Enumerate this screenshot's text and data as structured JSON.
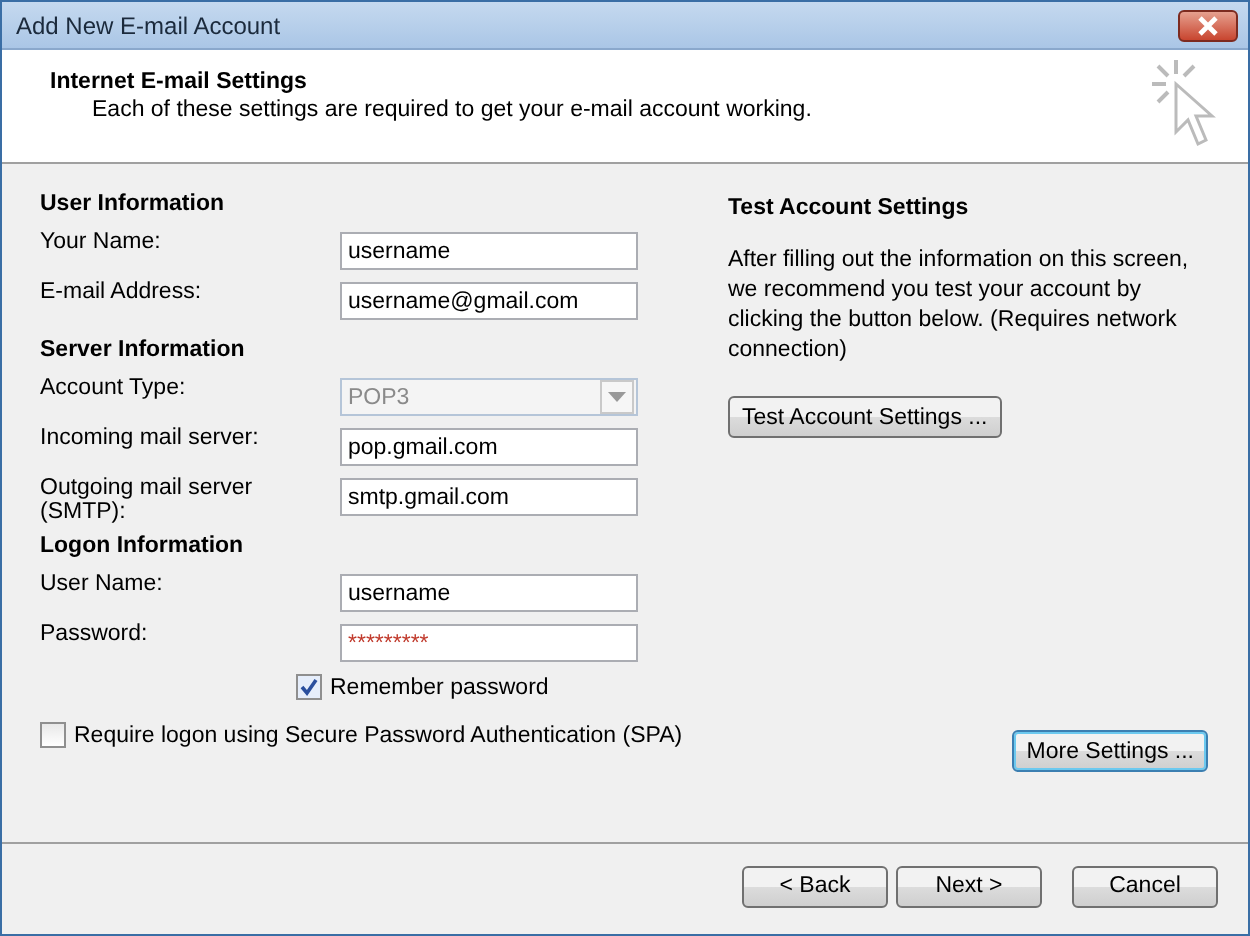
{
  "window": {
    "title": "Add New E-mail Account"
  },
  "header": {
    "title": "Internet E-mail Settings",
    "subtitle": "Each of these settings are required to get your e-mail account working."
  },
  "sections": [
    {
      "title": "User Information",
      "fields": [
        {
          "kind": "text",
          "label": "Your Name:",
          "value": "username",
          "disabled": false
        },
        {
          "kind": "text",
          "label": "E-mail Address:",
          "value": "username@gmail.com",
          "disabled": false
        }
      ]
    },
    {
      "title": "Server Information",
      "fields": [
        {
          "kind": "select",
          "label": "Account Type:",
          "value": "POP3",
          "disabled": true
        },
        {
          "kind": "text",
          "label": "Incoming mail server:",
          "value": "pop.gmail.com",
          "disabled": false
        },
        {
          "kind": "text",
          "label": "Outgoing mail server (SMTP):",
          "value": "smtp.gmail.com",
          "disabled": false
        }
      ]
    },
    {
      "title": "Logon Information",
      "fields": [
        {
          "kind": "text",
          "label": "User Name:",
          "value": "username",
          "disabled": false
        },
        {
          "kind": "password",
          "label": "Password:",
          "value": "*********",
          "disabled": false
        }
      ]
    }
  ],
  "remember_password": {
    "label": "Remember password",
    "checked": true
  },
  "require_spa": {
    "label": "Require logon using Secure Password Authentication (SPA)",
    "checked": false
  },
  "test": {
    "title": "Test Account Settings",
    "description": "After filling out the information on this screen, we recommend you test your account by clicking the button below. (Requires network connection)",
    "button": "Test Account Settings ..."
  },
  "more_settings": {
    "label": "More Settings ...",
    "focused": true
  },
  "buttons": [
    {
      "label": "< Back",
      "focused": false
    },
    {
      "label": "Next >",
      "focused": false
    },
    {
      "label": "Cancel",
      "focused": false
    }
  ]
}
